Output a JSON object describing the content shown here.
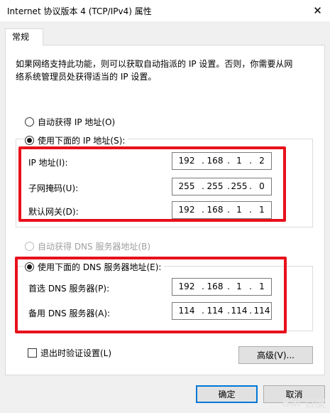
{
  "window": {
    "title": "Internet 协议版本 4 (TCP/IPv4) 属性",
    "close_glyph": "✕"
  },
  "tab": {
    "label": "常规"
  },
  "description": {
    "line1": "如果网络支持此功能，则可以获取自动指派的 IP 设置。否则，你需要从网",
    "line2": "络系统管理员处获得适当的 IP 设置。"
  },
  "ip_section": {
    "auto_label": "自动获得 IP 地址(O)",
    "auto_checked": false,
    "manual_label": "使用下面的 IP 地址(S):",
    "manual_checked": true,
    "fields": [
      {
        "label": "IP 地址(I):",
        "octets": [
          "192",
          "168",
          "1",
          "2"
        ]
      },
      {
        "label": "子网掩码(U):",
        "octets": [
          "255",
          "255",
          "255",
          "0"
        ]
      },
      {
        "label": "默认网关(D):",
        "octets": [
          "192",
          "168",
          "1",
          "1"
        ]
      }
    ]
  },
  "dns_section": {
    "auto_label": "自动获得 DNS 服务器地址(B)",
    "auto_checked": false,
    "auto_disabled": true,
    "manual_label": "使用下面的 DNS 服务器地址(E):",
    "manual_checked": true,
    "fields": [
      {
        "label": "首选 DNS 服务器(P):",
        "octets": [
          "192",
          "168",
          "1",
          "1"
        ]
      },
      {
        "label": "备用 DNS 服务器(A):",
        "octets": [
          "114",
          "114",
          "114",
          "114"
        ]
      }
    ]
  },
  "validate": {
    "label": "退出时验证设置(L)",
    "checked": false
  },
  "buttons": {
    "advanced": "高级(V)...",
    "ok": "确定",
    "cancel": "取消"
  },
  "watermark": "Bai 百度"
}
